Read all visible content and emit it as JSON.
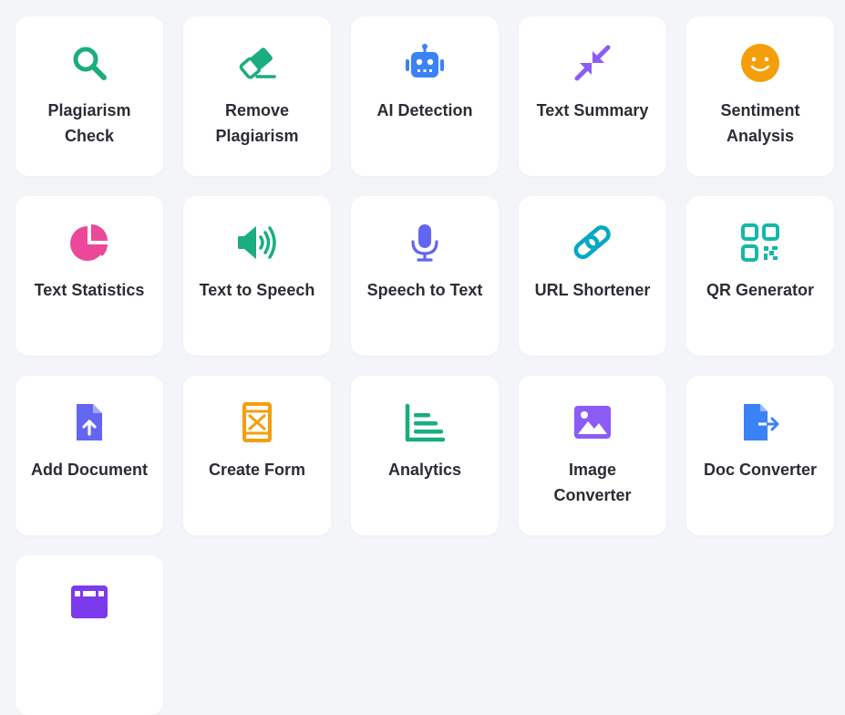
{
  "tools": [
    {
      "label": "Plagiarism Check",
      "icon": "search-icon",
      "color": "#1aad80"
    },
    {
      "label": "Remove Plagiarism",
      "icon": "eraser-icon",
      "color": "#1aad80"
    },
    {
      "label": "AI Detection",
      "icon": "robot-icon",
      "color": "#3b82f6"
    },
    {
      "label": "Text Summary",
      "icon": "compress-arrows-icon",
      "color": "#8b5cf6"
    },
    {
      "label": "Sentiment Analysis",
      "icon": "smiley-icon",
      "color": "#f59e0b"
    },
    {
      "label": "Text Statistics",
      "icon": "pie-chart-icon",
      "color": "#ec4899"
    },
    {
      "label": "Text to Speech",
      "icon": "speaker-icon",
      "color": "#1aad80"
    },
    {
      "label": "Speech to Text",
      "icon": "microphone-icon",
      "color": "#6366f1"
    },
    {
      "label": "URL Shortener",
      "icon": "link-icon",
      "color": "#06a8c7"
    },
    {
      "label": "QR Generator",
      "icon": "qr-code-icon",
      "color": "#14b8a6"
    },
    {
      "label": "Add Document",
      "icon": "file-upload-icon",
      "color": "#6366f1"
    },
    {
      "label": "Create Form",
      "icon": "form-icon",
      "color": "#f59e0b"
    },
    {
      "label": "Analytics",
      "icon": "bar-chart-icon",
      "color": "#1aad80"
    },
    {
      "label": "Image Converter",
      "icon": "image-icon",
      "color": "#8b5cf6"
    },
    {
      "label": "Doc Converter",
      "icon": "file-export-icon",
      "color": "#3b82f6"
    },
    {
      "label": "",
      "icon": "film-icon",
      "color": "#7c3aed"
    }
  ]
}
